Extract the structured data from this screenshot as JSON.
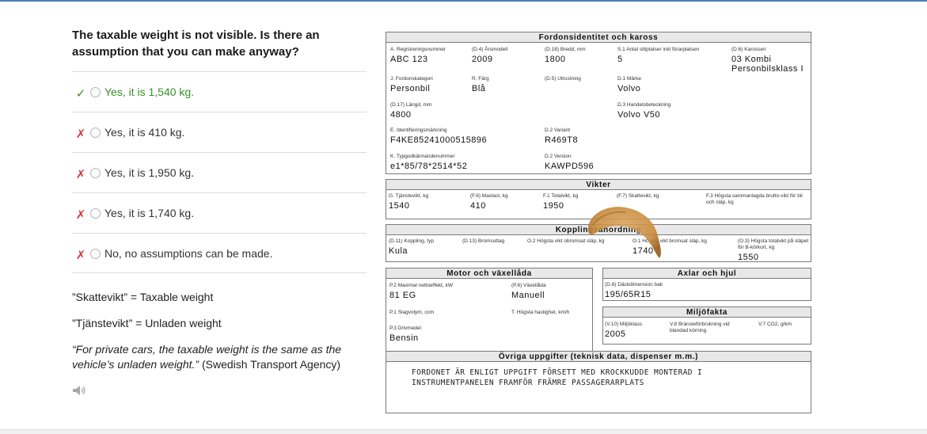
{
  "question": "The taxable weight is not visible. Is there an assumption that you can make anyway?",
  "options": [
    {
      "label": "Yes, it is 1,540 kg.",
      "mark": "✓"
    },
    {
      "label": "Yes, it is 410 kg.",
      "mark": "✗"
    },
    {
      "label": "Yes, it is 1,950 kg.",
      "mark": "✗"
    },
    {
      "label": "Yes, it is 1,740 kg.",
      "mark": "✗"
    },
    {
      "label": "No, no assumptions can be made.",
      "mark": "✗"
    }
  ],
  "notes": {
    "skattevikt": "”Skattevikt” = Taxable weight",
    "tjanstevikt": "”Tjänstevikt” = Unladen weight",
    "quote": "“For private cars, the taxable weight is the same as the vehicle’s unladen weight.”",
    "source": " (Swedish Transport Agency)"
  },
  "icons": {
    "audio": "speaker-icon",
    "correct": "check-icon",
    "wrong": "cross-icon"
  },
  "colors": {
    "correct": "#3a8f2a",
    "wrong": "#d43b3b",
    "topbar": "#4a7fb5"
  },
  "doc": {
    "identity": {
      "title": "Fordonsidentitet och kaross",
      "reg_label": "A. Registreringsnummer",
      "reg": "ABC 123",
      "year_label": "(D.4) Årsmodell",
      "year": "2009",
      "width_label": "(D.18) Bredd, mm",
      "width": "1800",
      "seats_label": "S.1 Antal sittplatser inkl förarplatsen",
      "seats": "5",
      "body_label": "(D.6) Karosseri",
      "body1": "03 Kombi",
      "body2": "Personbilsklass I",
      "category_label": "J. Fordonskategori",
      "category": "Personbil",
      "color_label": "R. Färg",
      "color": "Blå",
      "equipment_label": "(D.5) Utrustning",
      "make_label": "D.1 Märke",
      "make": "Volvo",
      "length_label": "(D.17) Längd, mm",
      "length": "4800",
      "tradename_label": "D.3 Handelsbeteckning",
      "tradename": "Volvo V50",
      "vin_label": "E. Identifieringsmärkning",
      "vin": "F4KE85241000515896",
      "variant_label": "D.2 Variant",
      "variant": "R469T8",
      "approval_label": "K. Typgodkännandenummer",
      "approval": "e1*85/78*2514*52",
      "version_label": "D.2 Version",
      "version": "KAWPD596"
    },
    "weights": {
      "title": "Vikter",
      "unladen_label": "G. Tjänstevikt, kg",
      "unladen": "1540",
      "maxload_label": "(F.6) Maxlast, kg",
      "maxload": "410",
      "total_label": "F.1 Totalvikt, kg",
      "total": "1950",
      "taxable_label": "(F.7) Skattevikt, kg",
      "combined_label": "F.3 Högsta sammanlagda brutto-vikt för bil och släp, kg"
    },
    "coupling": {
      "title": "Kopplingsanordning",
      "type_label": "(D.11) Koppling, typ",
      "type": "Kula",
      "brake_label": "(D.13) Bromsuttag",
      "unbraked_label": "O.2 Högsta vikt obromsat släp, kg",
      "braked_label": "O.1 Högsta vikt bromsat släp, kg",
      "braked": "1740",
      "bcard_label": "(O.3) Högsta totalvikt på släpet för B-körkort, kg",
      "bcard": "1550"
    },
    "engine": {
      "title": "Motor och växellåda",
      "power_label": "P.2 Maximal nettoeffekt, kW",
      "power": "81 EG",
      "gearbox_label": "(P.6) Växellåda",
      "gearbox": "Manuell",
      "volume_label": "P.1 Slagvolym, ccm",
      "speed_label": "T. Högsta hastighet, km/h",
      "fuel_label": "P.3 Drivmedel",
      "fuel": "Bensin"
    },
    "axles": {
      "title": "Axlar och hjul",
      "tyre_label": "(D.8) Däckdimension bak",
      "tyre": "195/65R15"
    },
    "environment": {
      "title": "Miljöfakta",
      "class_label": "(V.10) Miljöklass",
      "class": "2005",
      "consumption_label": "V.8 Bränsleförbrukning vid blandad körning",
      "co2_label": "V.7 CO2, g/km"
    },
    "other": {
      "title": "Övriga uppgifter (teknisk data, dispenser m.m.)",
      "line1": "FORDONET ÄR ENLIGT UPPGIFT FÖRSETT MED KROCKKUDDE MONTERAD I",
      "line2": "INSTRUMENTPANELEN FRAMFÖR FRÄMRE PASSAGERARPLATS"
    }
  }
}
